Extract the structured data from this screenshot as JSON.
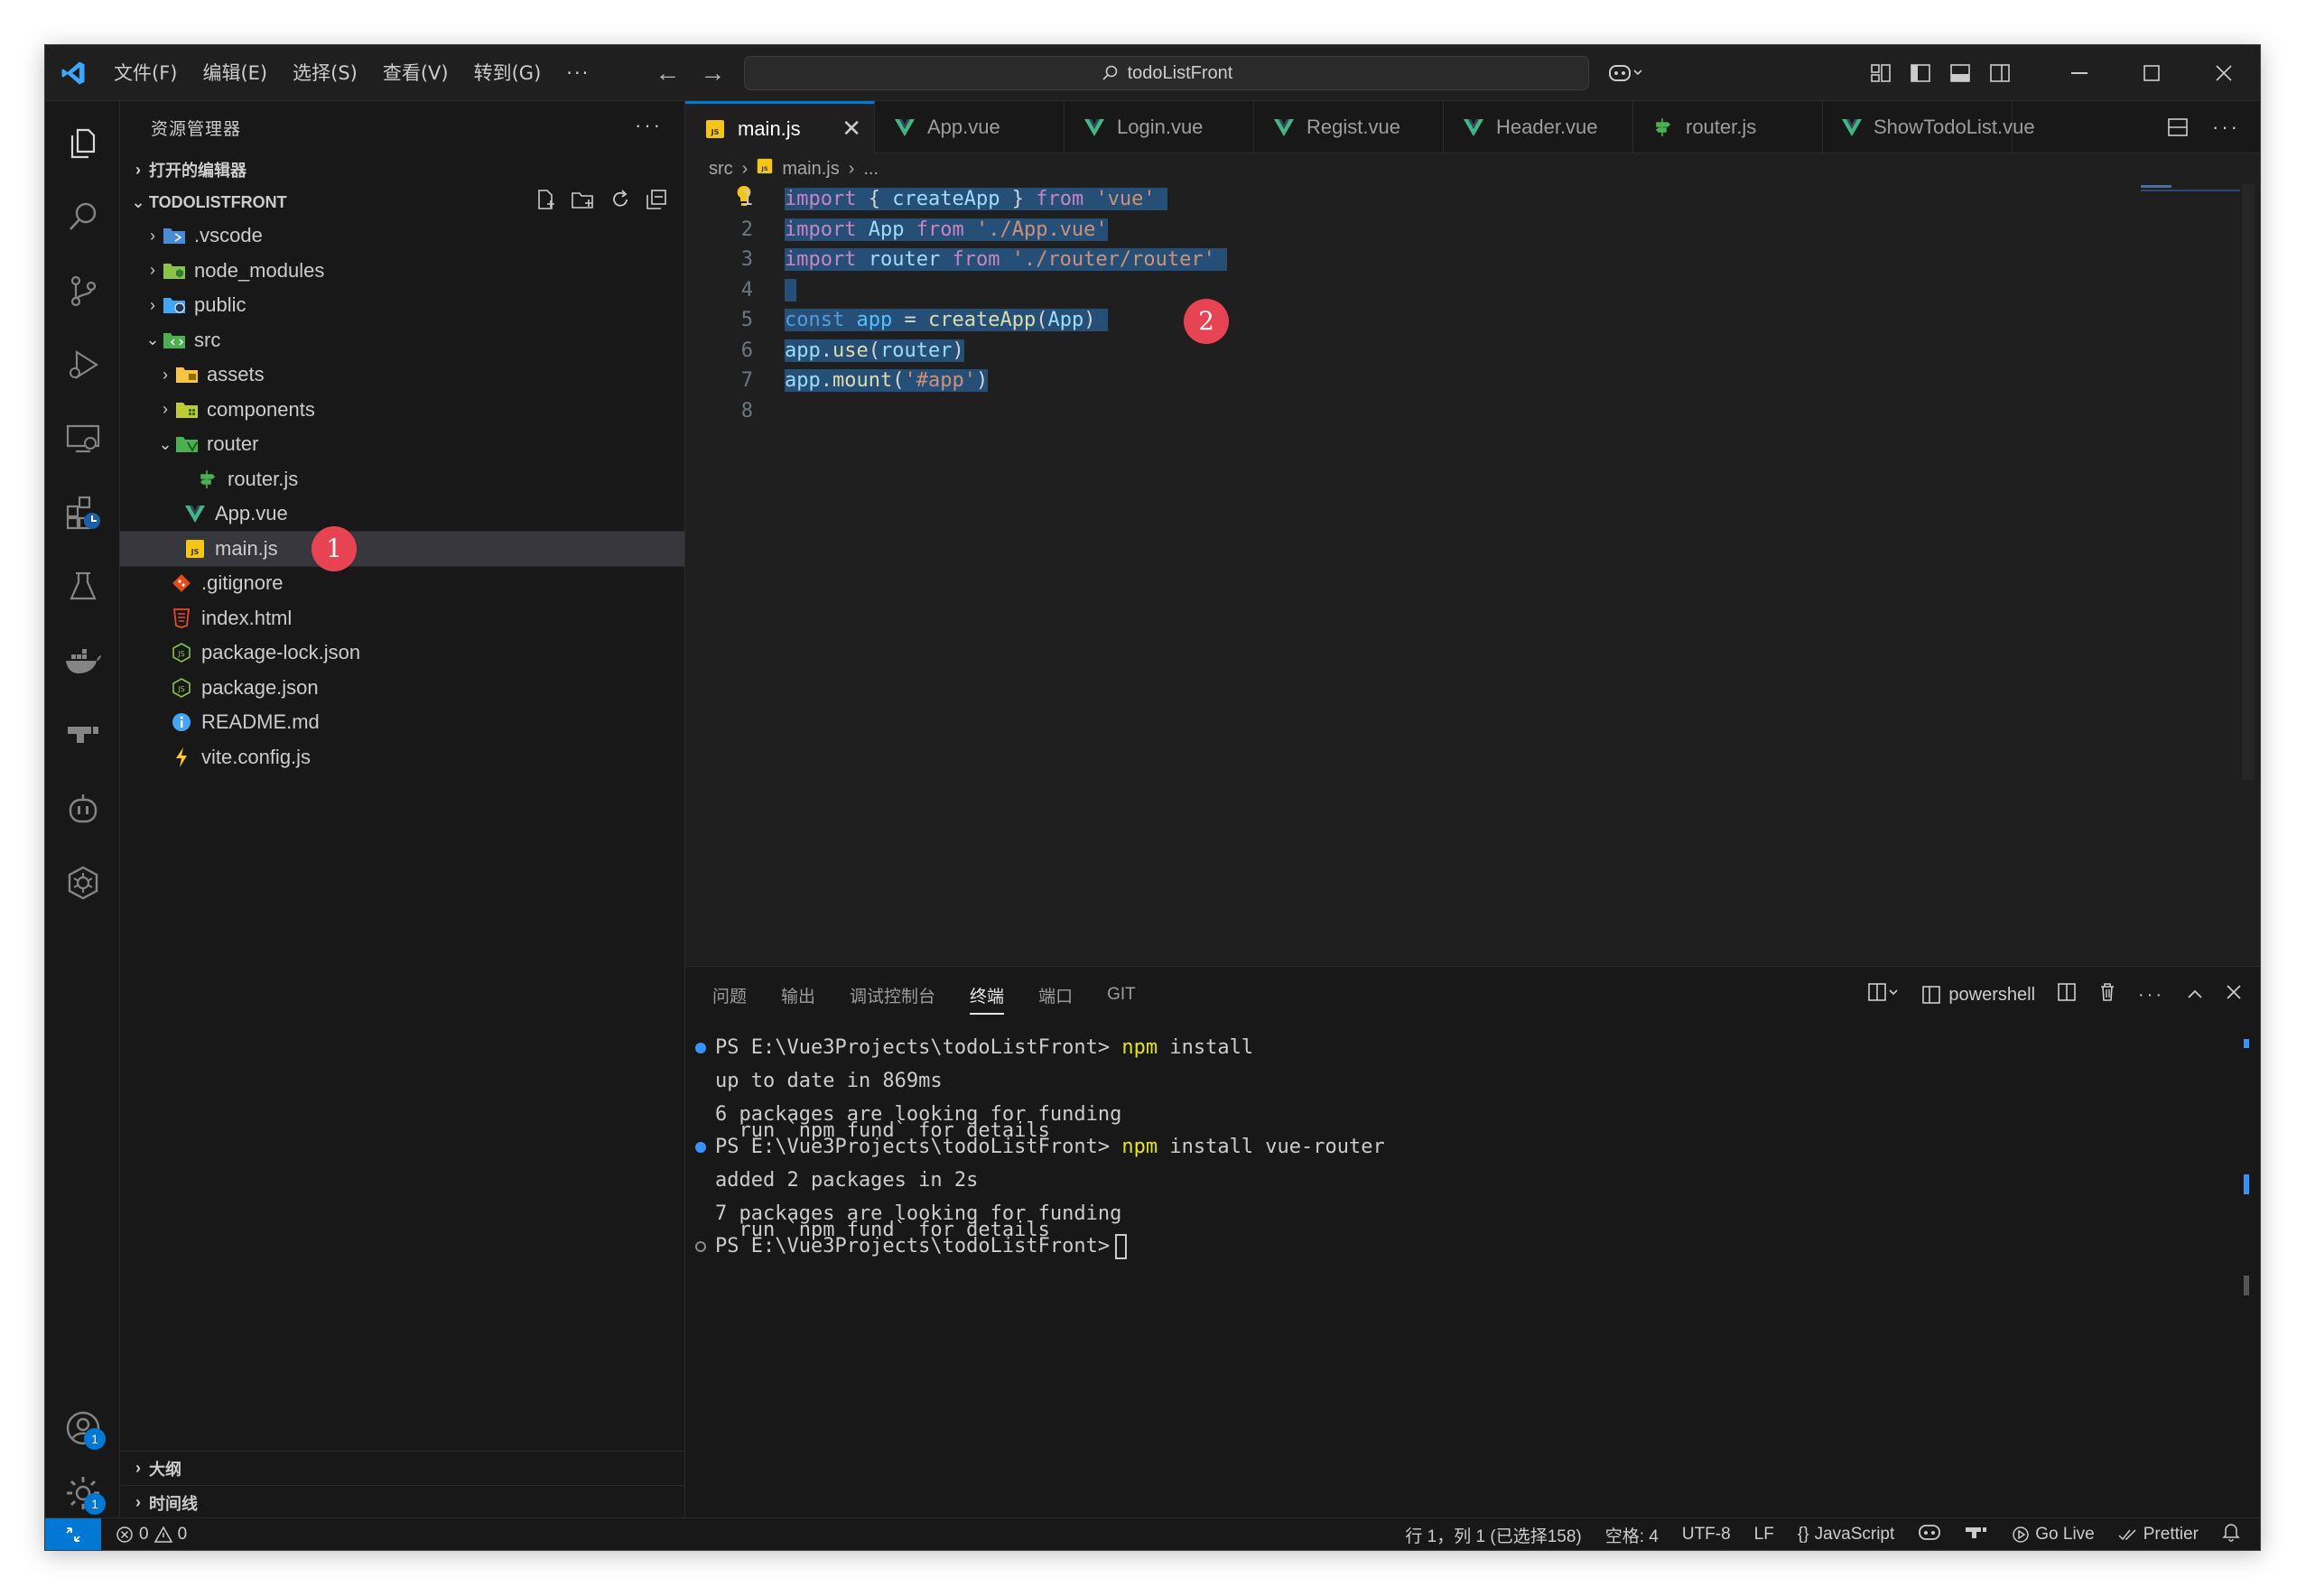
{
  "menu": [
    "文件(F)",
    "编辑(E)",
    "选择(S)",
    "查看(V)",
    "转到(G)",
    "···"
  ],
  "command_center": "todoListFront",
  "sidebar": {
    "title": "资源管理器",
    "open_editors": "打开的编辑器",
    "project": "TODOLISTFRONT",
    "tree": [
      {
        "label": ".vscode",
        "type": "folder",
        "icon": "vscode-folder-icon"
      },
      {
        "label": "node_modules",
        "type": "folder",
        "icon": "node-folder-icon"
      },
      {
        "label": "public",
        "type": "folder",
        "icon": "public-folder-icon"
      },
      {
        "label": "src",
        "type": "folder-open",
        "icon": "src-folder-icon"
      },
      {
        "label": "assets",
        "type": "folder",
        "icon": "assets-folder-icon"
      },
      {
        "label": "components",
        "type": "folder",
        "icon": "components-folder-icon"
      },
      {
        "label": "router",
        "type": "folder-open",
        "icon": "router-folder-icon"
      },
      {
        "label": "router.js",
        "type": "file",
        "icon": "router-file-icon"
      },
      {
        "label": "App.vue",
        "type": "file",
        "icon": "vue-file-icon"
      },
      {
        "label": "main.js",
        "type": "file",
        "icon": "js-file-icon"
      },
      {
        "label": ".gitignore",
        "type": "file",
        "icon": "git-file-icon"
      },
      {
        "label": "index.html",
        "type": "file",
        "icon": "html-file-icon"
      },
      {
        "label": "package-lock.json",
        "type": "file",
        "icon": "node-json-file-icon"
      },
      {
        "label": "package.json",
        "type": "file",
        "icon": "node-json-file-icon"
      },
      {
        "label": "README.md",
        "type": "file",
        "icon": "info-file-icon"
      },
      {
        "label": "vite.config.js",
        "type": "file",
        "icon": "vite-file-icon"
      }
    ],
    "outline": "大纲",
    "timeline": "时间线",
    "marker_1": "1"
  },
  "tabs": [
    {
      "label": "main.js",
      "icon": "js-file-icon",
      "active": true
    },
    {
      "label": "App.vue",
      "icon": "vue-file-icon"
    },
    {
      "label": "Login.vue",
      "icon": "vue-file-icon"
    },
    {
      "label": "Regist.vue",
      "icon": "vue-file-icon"
    },
    {
      "label": "Header.vue",
      "icon": "vue-file-icon"
    },
    {
      "label": "router.js",
      "icon": "router-file-icon"
    },
    {
      "label": "ShowTodoList.vue",
      "icon": "vue-file-icon"
    }
  ],
  "breadcrumb": {
    "folder": "src",
    "file": "main.js",
    "rest": "..."
  },
  "code": {
    "line_numbers": [
      "1",
      "2",
      "3",
      "4",
      "5",
      "6",
      "7",
      "8"
    ],
    "lines": [
      "import { createApp } from 'vue'",
      "import App from './App.vue'",
      "import router from './router/router'",
      "",
      "const app = createApp(App)",
      "app.use(router)",
      "app.mount('#app')",
      ""
    ],
    "marker_2": "2"
  },
  "panel": {
    "tabs": [
      "问题",
      "输出",
      "调试控制台",
      "终端",
      "端口",
      "GIT"
    ],
    "active_tab": "终端",
    "shell": "powershell",
    "terminal": {
      "prompt": "PS E:\\Vue3Projects\\todoListFront>",
      "cmd1_bin": "npm",
      "cmd1_args": "install",
      "out1": "up to date in 869ms",
      "out2": "6 packages are looking for funding",
      "out3": "  run `npm fund` for details",
      "cmd2_bin": "npm",
      "cmd2_args": "install vue-router",
      "out4": "added 2 packages in 2s",
      "out5": "7 packages are looking for funding",
      "out6": "  run `npm fund` for details"
    }
  },
  "status": {
    "errors": "0",
    "warnings": "0",
    "position": "行 1，列 1 (已选择158)",
    "spaces": "空格: 4",
    "encoding": "UTF-8",
    "eol": "LF",
    "language": "JavaScript",
    "golive": "Go Live",
    "prettier": "Prettier"
  },
  "colors": {
    "accent": "#0078d4",
    "marker": "#e84352",
    "bg": "#1f1f1f",
    "sidebar": "#181818"
  }
}
